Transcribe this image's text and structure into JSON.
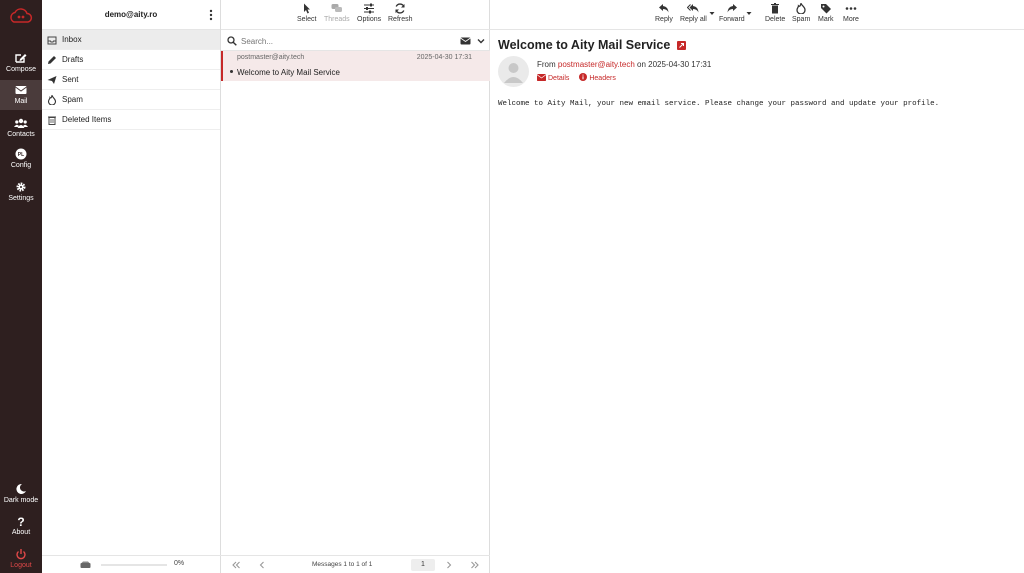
{
  "nav": {
    "items": [
      {
        "label": "Compose"
      },
      {
        "label": "Mail"
      },
      {
        "label": "Contacts"
      },
      {
        "label": "Config"
      },
      {
        "label": "Settings"
      }
    ],
    "bottom": [
      {
        "label": "Dark mode"
      },
      {
        "label": "About"
      },
      {
        "label": "Logout"
      }
    ]
  },
  "account": {
    "email": "demo@aity.ro"
  },
  "folders": [
    {
      "label": "Inbox",
      "icon": "inbox-icon"
    },
    {
      "label": "Drafts",
      "icon": "pencil-icon"
    },
    {
      "label": "Sent",
      "icon": "paper-plane-icon"
    },
    {
      "label": "Spam",
      "icon": "fire-icon"
    },
    {
      "label": "Deleted Items",
      "icon": "trash-icon"
    }
  ],
  "quota": {
    "percent_text": "0%",
    "fraction": 0
  },
  "list_toolbar": {
    "select": "Select",
    "threads": "Threads",
    "options": "Options",
    "refresh": "Refresh"
  },
  "search": {
    "placeholder": "Search..."
  },
  "messages": [
    {
      "from": "postmaster@aity.tech",
      "date": "2025-04-30 17:31",
      "subject": "Welcome to Aity Mail Service"
    }
  ],
  "pager": {
    "count_text": "Messages 1 to 1 of 1",
    "page": "1"
  },
  "reader_toolbar": {
    "reply": "Reply",
    "reply_all": "Reply all",
    "forward": "Forward",
    "delete": "Delete",
    "spam": "Spam",
    "mark": "Mark",
    "more": "More"
  },
  "reader": {
    "subject": "Welcome to Aity Mail Service",
    "from_prefix": "From",
    "from_address": "postmaster@aity.tech",
    "on_text": "on 2025-04-30 17:31",
    "details": "Details",
    "headers": "Headers",
    "body": "Welcome to Aity Mail, your new email service. Please change your password and update your profile."
  },
  "colors": {
    "accent": "#c62828",
    "nav_bg": "#2e1f1f"
  }
}
